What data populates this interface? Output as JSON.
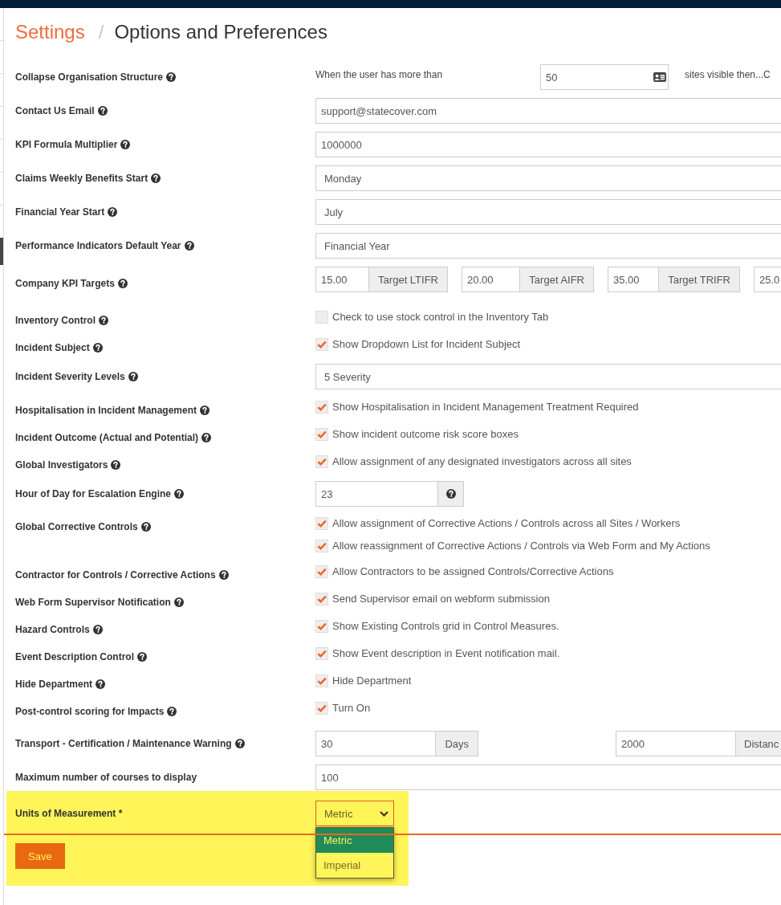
{
  "breadcrumb": {
    "items": [
      {
        "label": "Settings",
        "kind": "link"
      },
      {
        "label": "Options and Preferences",
        "kind": "current"
      }
    ],
    "separator": "/"
  },
  "settings": [
    {
      "label": "Collapse Organisation Structure",
      "help": true,
      "control": {
        "kind": "threshold",
        "prefix": "When the user has more than",
        "value": "50",
        "suffix": "sites visible then...C"
      }
    },
    {
      "label": "Contact Us Email",
      "help": true,
      "control": {
        "kind": "input",
        "value": "support@statecover.com"
      }
    },
    {
      "label": "KPI Formula Multiplier",
      "help": true,
      "control": {
        "kind": "input",
        "value": "1000000"
      }
    },
    {
      "label": "Claims Weekly Benefits Start",
      "help": true,
      "control": {
        "kind": "select",
        "value": "Monday"
      }
    },
    {
      "label": "Financial Year Start",
      "help": true,
      "control": {
        "kind": "select",
        "value": "July"
      }
    },
    {
      "label": "Performance Indicators Default Year",
      "help": true,
      "control": {
        "kind": "select",
        "value": "Financial Year"
      }
    },
    {
      "label": "Company KPI Targets",
      "help": true,
      "control": {
        "kind": "addon_grid",
        "groups": [
          {
            "value": "15.00",
            "addon": "Target LTIFR"
          },
          {
            "value": "20.00",
            "addon": "Target AIFR"
          },
          {
            "value": "35.00",
            "addon": "Target TRIFR"
          },
          {
            "value": "25.0"
          }
        ]
      }
    },
    {
      "label": "Inventory Control",
      "help": true,
      "control": {
        "kind": "checkboxes",
        "checks": [
          {
            "text": "Check to use stock control in the Inventory Tab",
            "checked": false
          }
        ]
      }
    },
    {
      "label": "Incident Subject",
      "help": true,
      "control": {
        "kind": "checkboxes",
        "checks": [
          {
            "text": "Show Dropdown List for Incident Subject",
            "checked": true
          }
        ]
      }
    },
    {
      "label": "Incident Severity Levels",
      "help": true,
      "control": {
        "kind": "select",
        "value": "5 Severity"
      }
    },
    {
      "label": "Hospitalisation in Incident Management",
      "help": true,
      "control": {
        "kind": "checkboxes",
        "checks": [
          {
            "text": "Show Hospitalisation in Incident Management Treatment Required",
            "checked": true
          }
        ]
      }
    },
    {
      "label": "Incident Outcome (Actual and Potential)",
      "help": true,
      "control": {
        "kind": "checkboxes",
        "checks": [
          {
            "text": "Show incident outcome risk score boxes",
            "checked": true
          }
        ]
      }
    },
    {
      "label": "Global Investigators",
      "help": true,
      "control": {
        "kind": "checkboxes",
        "checks": [
          {
            "text": "Allow assignment of any designated investigators across all sites",
            "checked": true
          }
        ]
      }
    },
    {
      "label": "Hour of Day for Escalation Engine",
      "help": true,
      "control": {
        "kind": "input_help",
        "value": "23"
      }
    },
    {
      "label": "Global Corrective Controls",
      "help": true,
      "control": {
        "kind": "checkboxes",
        "checks": [
          {
            "text": "Allow assignment of Corrective Actions / Controls across all Sites / Workers",
            "checked": true
          },
          {
            "text": "Allow reassignment of Corrective Actions / Controls via Web Form and My Actions",
            "checked": true
          }
        ]
      }
    },
    {
      "label": "Contractor for Controls / Corrective Actions",
      "help": true,
      "control": {
        "kind": "checkboxes",
        "checks": [
          {
            "text": "Allow Contractors to be assigned Controls/Corrective Actions",
            "checked": true
          }
        ]
      }
    },
    {
      "label": "Web Form Supervisor Notification",
      "help": true,
      "control": {
        "kind": "checkboxes",
        "checks": [
          {
            "text": "Send Supervisor email on webform submission",
            "checked": true
          }
        ]
      }
    },
    {
      "label": "Hazard Controls",
      "help": true,
      "control": {
        "kind": "checkboxes",
        "checks": [
          {
            "text": "Show Existing Controls grid in Control Measures.",
            "checked": true
          }
        ]
      }
    },
    {
      "label": "Event Description Control",
      "help": true,
      "control": {
        "kind": "checkboxes",
        "checks": [
          {
            "text": "Show Event description in Event notification mail.",
            "checked": true
          }
        ]
      }
    },
    {
      "label": "Hide Department",
      "help": true,
      "control": {
        "kind": "checkboxes",
        "checks": [
          {
            "text": "Hide Department",
            "checked": true
          }
        ]
      }
    },
    {
      "label": "Post-control scoring for Impacts",
      "help": true,
      "control": {
        "kind": "checkboxes",
        "checks": [
          {
            "text": "Turn On",
            "checked": true
          }
        ]
      }
    },
    {
      "label": "Transport - Certification / Maintenance Warning",
      "help": true,
      "control": {
        "kind": "addon_pair",
        "groups": [
          {
            "value": "30",
            "addon": "Days"
          },
          {
            "value": "2000",
            "addon": "Distanc"
          }
        ]
      }
    },
    {
      "label": "Maximum number of courses to display",
      "help": false,
      "control": {
        "kind": "input",
        "value": "100"
      }
    }
  ],
  "units": {
    "label": "Units of Measurement *",
    "help": false,
    "value": "Metric",
    "expanded": true,
    "highlighted": true,
    "options": [
      {
        "label": "Metric",
        "selected": true
      },
      {
        "label": "Imperial",
        "selected": false
      }
    ]
  },
  "save_button": {
    "label": "Save"
  }
}
